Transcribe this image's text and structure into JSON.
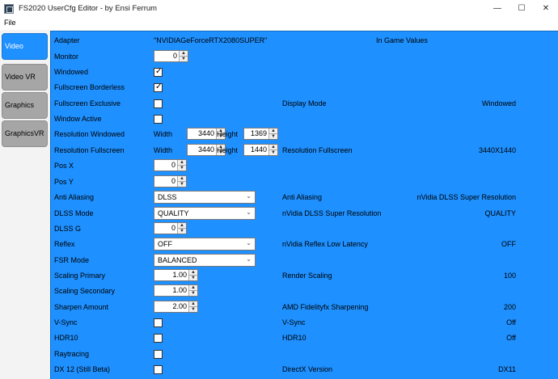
{
  "window": {
    "title": "FS2020 UserCfg Editor - by Ensi Ferrum",
    "minimize": "—",
    "maximize": "☐",
    "close": "✕"
  },
  "menu": {
    "file": "File"
  },
  "tabs": [
    "Video",
    "Video VR",
    "Graphics",
    "GraphicsVR"
  ],
  "active_tab": "Video",
  "rows": {
    "adapter": {
      "label": "Adapter",
      "value": "\"NVIDIAGeForceRTX2080SUPER\"",
      "header": "In Game Values"
    },
    "monitor": {
      "label": "Monitor",
      "value": "0"
    },
    "windowed": {
      "label": "Windowed",
      "checked": true
    },
    "fullscreen_borderless": {
      "label": "Fullscreen Borderless",
      "checked": true
    },
    "fullscreen_exclusive": {
      "label": "Fullscreen Exclusive",
      "checked": false,
      "ig_label": "Display Mode",
      "ig_value": "Windowed"
    },
    "window_active": {
      "label": "Window Active",
      "checked": false
    },
    "resolution_windowed": {
      "label": "Resolution Windowed",
      "width_label": "Width",
      "width": "3440",
      "height_label": "Height",
      "height": "1369"
    },
    "resolution_fullscreen": {
      "label": "Resolution Fullscreen",
      "width_label": "Width",
      "width": "3440",
      "height_label": "Height",
      "height": "1440",
      "ig_label": "Resolution Fullscreen",
      "ig_value": "3440X1440"
    },
    "pos_x": {
      "label": "Pos X",
      "value": "0"
    },
    "pos_y": {
      "label": "Pos Y",
      "value": "0"
    },
    "anti_aliasing": {
      "label": "Anti Aliasing",
      "value": "DLSS",
      "ig_label": "Anti Aliasing",
      "ig_value": "nVidia DLSS Super Resolution"
    },
    "dlss_mode": {
      "label": "DLSS Mode",
      "value": "QUALITY",
      "ig_label": "nVidia DLSS Super Resolution",
      "ig_value": "QUALITY"
    },
    "dlss_g": {
      "label": "DLSS G",
      "value": "0"
    },
    "reflex": {
      "label": "Reflex",
      "value": "OFF",
      "ig_label": "nVidia Reflex Low Latency",
      "ig_value": "OFF"
    },
    "fsr_mode": {
      "label": "FSR Mode",
      "value": "BALANCED"
    },
    "scaling_primary": {
      "label": "Scaling Primary",
      "value": "1.00",
      "ig_label": "Render Scaling",
      "ig_value": "100"
    },
    "scaling_secondary": {
      "label": "Scaling Secondary",
      "value": "1.00"
    },
    "sharpen_amount": {
      "label": "Sharpen Amount",
      "value": "2.00",
      "ig_label": "AMD Fidelityfx Sharpening",
      "ig_value": "200"
    },
    "vsync": {
      "label": "V-Sync",
      "checked": false,
      "ig_label": "V-Sync",
      "ig_value": "Off"
    },
    "hdr10": {
      "label": "HDR10",
      "checked": false,
      "ig_label": "HDR10",
      "ig_value": "Off"
    },
    "raytracing": {
      "label": "Raytracing",
      "checked": false
    },
    "dx12": {
      "label": "DX 12 (Still Beta)",
      "checked": false,
      "ig_label": "DirectX Version",
      "ig_value": "DX11"
    }
  },
  "colors": {
    "panel": "#1e90ff",
    "active_tab": "#1e90ff",
    "inactive_tab": "#a6a6a6"
  },
  "icons": {
    "spinner": "up-down-arrows",
    "dropdown": "chevron-down-icon",
    "checkbox": "checkmark"
  }
}
